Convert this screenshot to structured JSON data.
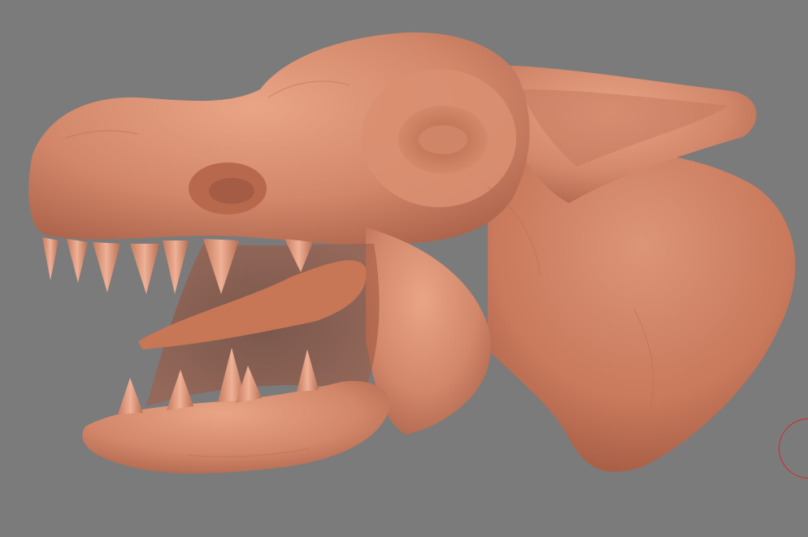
{
  "viewport": {
    "background_color": "#7b7b7b",
    "model": {
      "subject": "creature-head-sculpt",
      "material_color": "#d2876a",
      "material_shadow_color": "#a55c44",
      "material_highlight_color": "#efb197"
    },
    "brush_cursor": {
      "color": "#d8262a",
      "icon": "brush-circle-icon"
    }
  }
}
